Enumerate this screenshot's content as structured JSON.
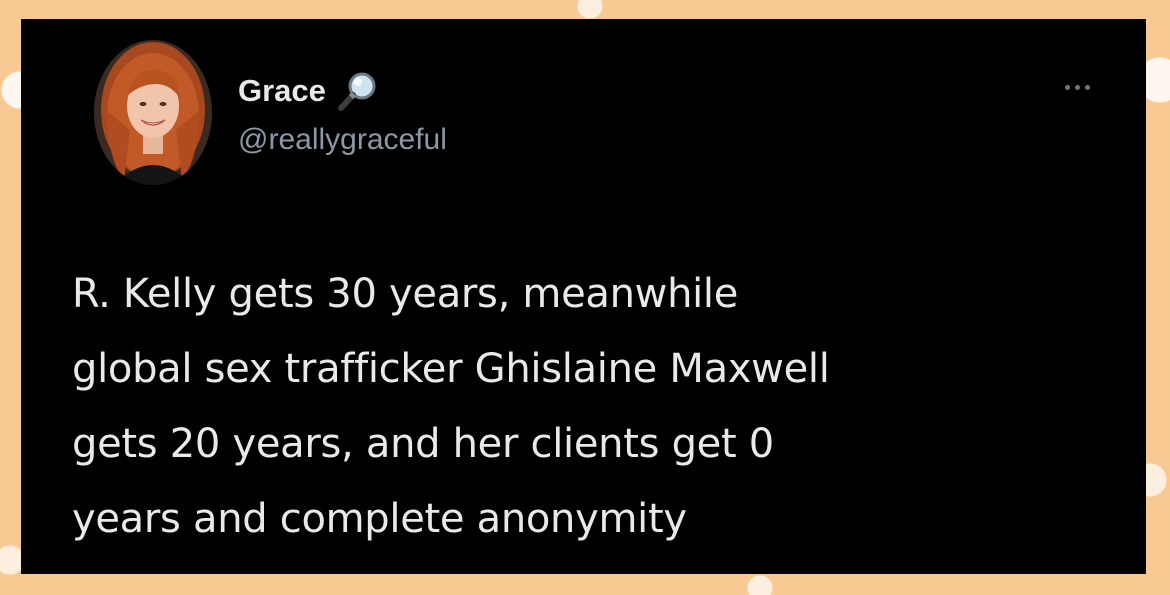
{
  "tweet": {
    "author": {
      "display_name": "Grace",
      "name_emoji": "magnifying-glass-emoji",
      "handle": "@reallygraceful"
    },
    "more_icon": "more-horizontal-icon",
    "text": "R. Kelly gets 30 years, meanwhile\nglobal sex trafficker Ghislaine Maxwell\ngets 20 years, and her clients get 0\nyears and complete anonymity"
  },
  "colors": {
    "card_background": "#000000",
    "frame_background": "#f8c993",
    "primary_text": "#e7e9ea",
    "secondary_text": "#8b98a5"
  }
}
